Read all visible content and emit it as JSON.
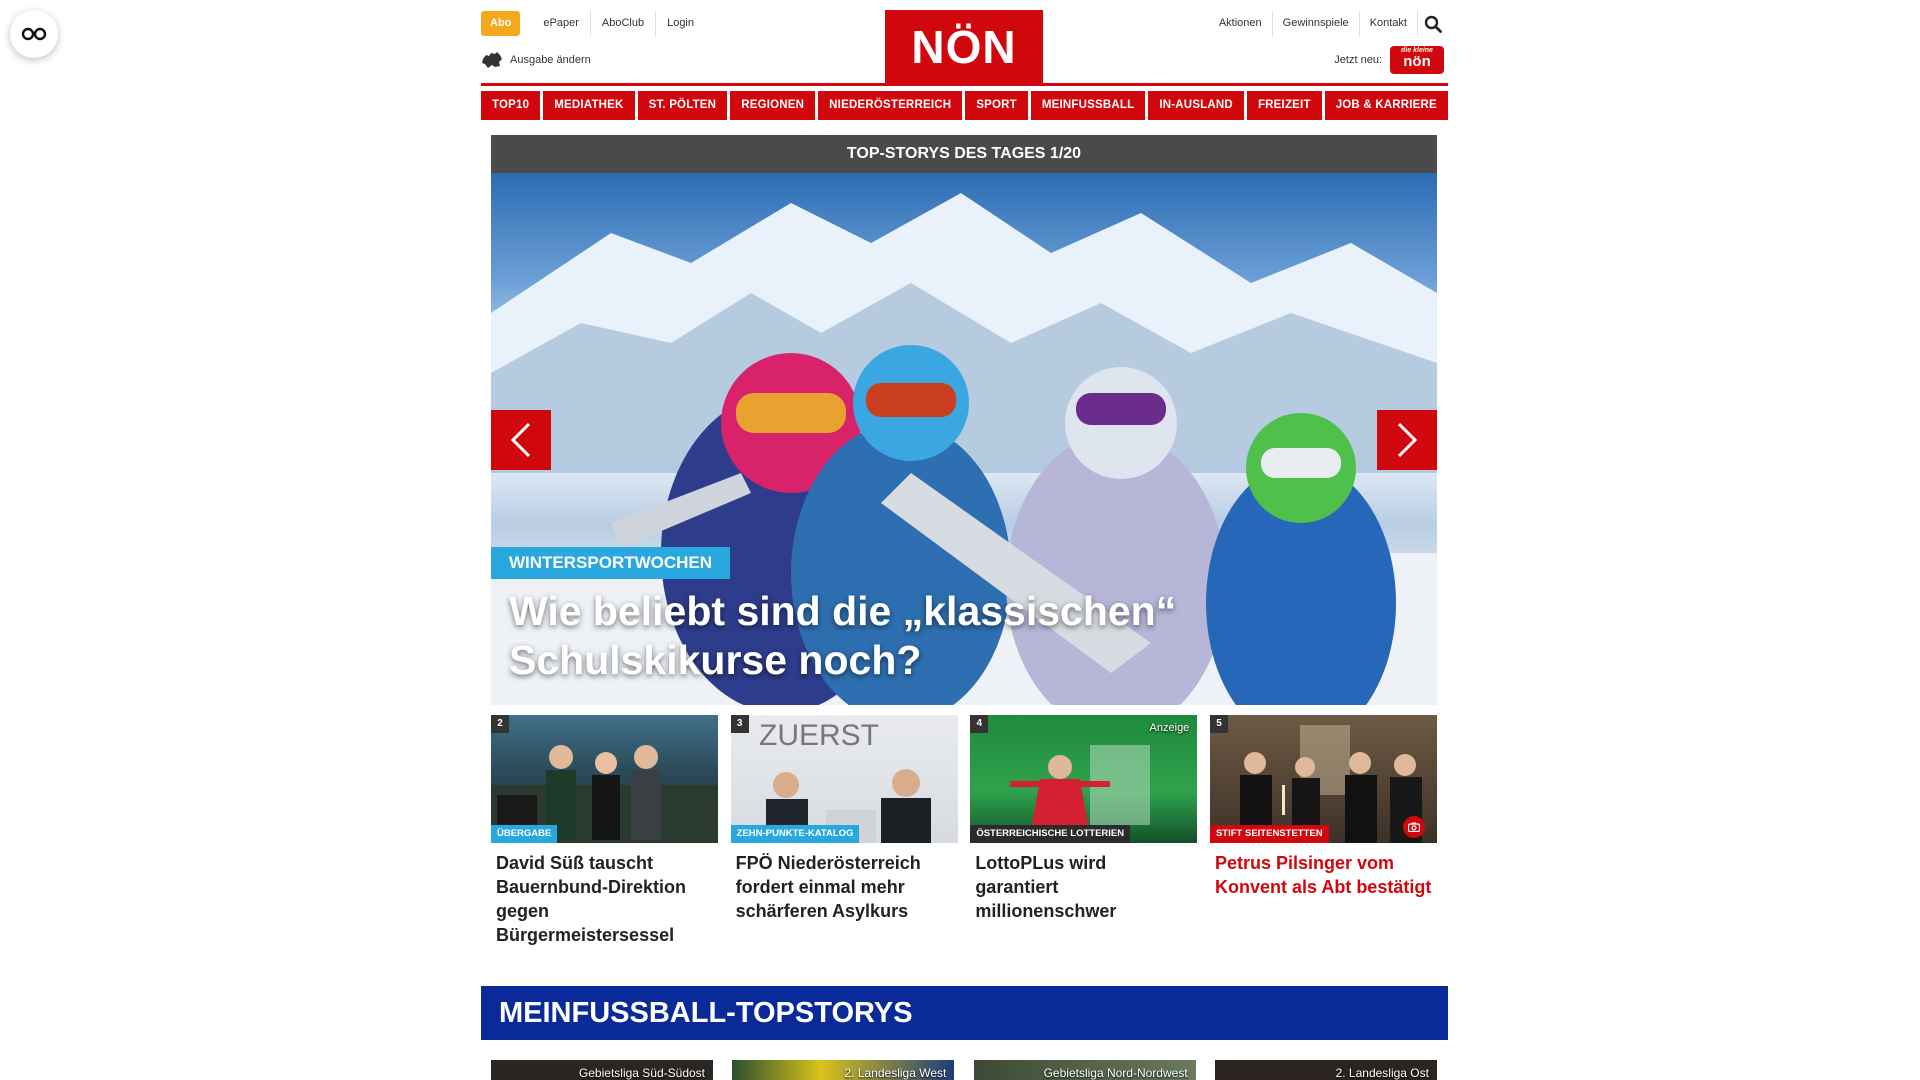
{
  "utility": {
    "abo": "Abo",
    "links": [
      "ePaper",
      "AboClub",
      "Login"
    ],
    "ausgabe": "Ausgabe ändern"
  },
  "logo": "NÖN",
  "rightnav": {
    "links": [
      "Aktionen",
      "Gewinnspiele",
      "Kontakt"
    ],
    "jetzt_neu": "Jetzt neu:",
    "kinder_small": "die kleine",
    "kinder_big": "nön"
  },
  "nav": [
    "TOP10",
    "MEDIATHEK",
    "ST. PÖLTEN",
    "REGIONEN",
    "NIEDERÖSTERREICH",
    "SPORT",
    "MEINFUSSBALL",
    "IN-AUSLAND",
    "FREIZEIT",
    "JOB & KARRIERE"
  ],
  "hero": {
    "bar_title": "TOP-STORYS DES TAGES 1/20",
    "tag": "WINTERSPORTWOCHEN",
    "headline": "Wie beliebt sind die „klassischen“ Schulskikurse noch?"
  },
  "cards": [
    {
      "num": "2",
      "tag": "ÜBERGABE",
      "title": "David Süß tauscht Bauernbund-Direktion gegen Bürgermeistersessel"
    },
    {
      "num": "3",
      "tag": "ZEHN-PUNKTE-KATALOG",
      "title": "FPÖ Niederösterreich fordert einmal mehr schärferen Asylkurs",
      "img_text": "ZUERST"
    },
    {
      "num": "4",
      "tag": "ÖSTERREICHISCHE LOTTERIEN",
      "title": "LottoPLus wird garantiert millionenschwer",
      "anzeige": "Anzeige"
    },
    {
      "num": "5",
      "tag": "STIFT SEITENSTETTEN",
      "title": "Petrus Pilsinger vom Konvent als Abt bestätigt"
    }
  ],
  "fussball": {
    "title": "MEINFUSSBALL-TOPSTORYS",
    "cards": [
      "Gebietsliga Süd-Südost",
      "2. Landesliga West",
      "Gebietsliga Nord-Nordwest",
      "2. Landesliga Ost"
    ]
  },
  "colors": {
    "brand_red": "#d1070e",
    "abo_orange": "#f5a81c",
    "tag_blue": "#29a8e0",
    "fussball_blue": "#0a2a9a"
  }
}
